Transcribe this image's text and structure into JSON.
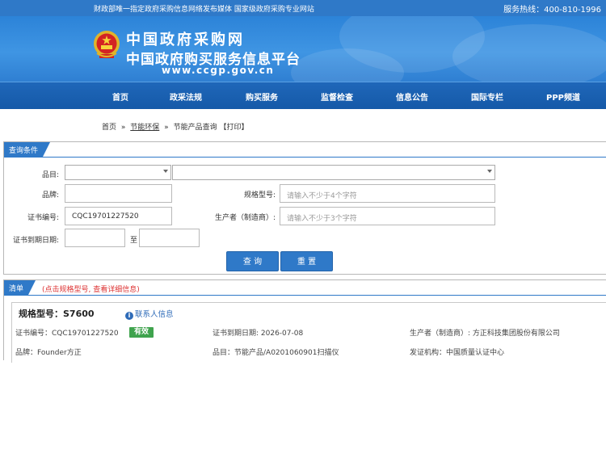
{
  "topbar": {
    "notice": "财政部唯一指定政府采购信息网络发布媒体 国家级政府采购专业网站",
    "hotline": "服务热线：400-810-1996"
  },
  "brand": {
    "title": "中国政府采购网",
    "subtitle": "中国政府购买服务信息平台",
    "url": "www.ccgp.gov.cn"
  },
  "nav": {
    "items": [
      {
        "label": "首页"
      },
      {
        "label": "政采法规"
      },
      {
        "label": "购买服务"
      },
      {
        "label": "监督检查"
      },
      {
        "label": "信息公告"
      },
      {
        "label": "国际专栏"
      },
      {
        "label": "PPP频道"
      }
    ]
  },
  "breadcrumb": {
    "home": "首页",
    "sep1": "»",
    "category": "节能环保",
    "sep2": "»",
    "current": "节能产品查询",
    "print": "【打印】"
  },
  "query": {
    "title": "查询条件",
    "category_label": "品目:",
    "brand_label": "品牌:",
    "brand_value": "",
    "model_label": "规格型号:",
    "model_placeholder": "请输入不少于4个字符",
    "cert_label": "证书编号:",
    "cert_value": "CQC19701227520",
    "maker_label": "生产者（制造商）:",
    "maker_placeholder": "请输入不少于3个字符",
    "expiry_label": "证书到期日期:",
    "expiry_to": "至",
    "search_button": "查 询",
    "reset_button": "重 置"
  },
  "results": {
    "title": "清单",
    "hint": "(点击规格型号, 查看详细信息)",
    "items": [
      {
        "model": "规格型号：S7600",
        "contact": "联系人信息",
        "cert_no": "证书编号：CQC19701227520",
        "status": "有效",
        "expiry": "证书到期日期: 2026-07-08",
        "manufacturer": "生产者（制造商）: 方正科技集团股份有限公司",
        "brand": "品牌：Founder方正",
        "category": "品目：节能产品/A0201060901扫描仪",
        "issuer": "发证机构：中国质量认证中心"
      }
    ]
  },
  "colors": {
    "topbar": "#2f79c8",
    "nav": "#1a5fb0",
    "tab": "#2f79c8",
    "status_valid": "#3fa34d",
    "hint": "#dd3333"
  },
  "icons": {
    "emblem": "national-emblem-icon",
    "info": "info-icon",
    "caret": "chevron-down-icon"
  }
}
